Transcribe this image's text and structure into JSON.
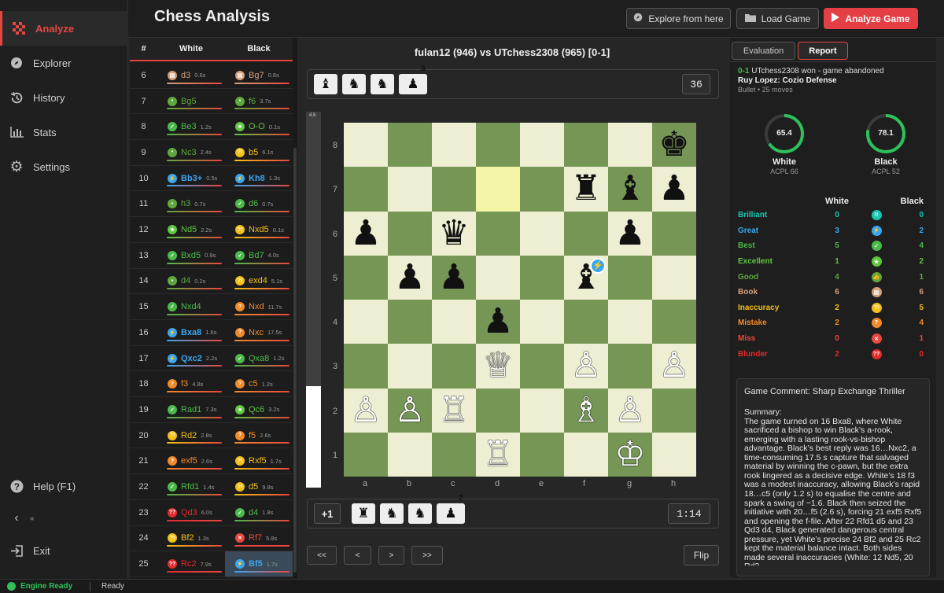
{
  "app": {
    "logo_label": "Analyze",
    "title": "Chess Analysis"
  },
  "sidebar": {
    "items": [
      {
        "label": "Explorer",
        "icon": "compass-icon"
      },
      {
        "label": "History",
        "icon": "history-icon"
      },
      {
        "label": "Stats",
        "icon": "bar-chart-icon"
      },
      {
        "label": "Settings",
        "icon": "gear-icon"
      }
    ],
    "bottom": [
      {
        "label": "Help (F1)",
        "icon": "help-icon"
      },
      {
        "label": "Exit",
        "icon": "exit-icon"
      }
    ],
    "collapse_label": "«"
  },
  "header": {
    "explore_label": "Explore from here",
    "load_label": "Load Game",
    "analyze_label": "Analyze Game"
  },
  "moves_table": {
    "headers": [
      "#",
      "White",
      "Black"
    ],
    "rows": [
      {
        "n": "6",
        "w": "d3",
        "wt": "0.6s",
        "wc": "book",
        "b": "Bg7",
        "bt": "0.6s",
        "bc": "book"
      },
      {
        "n": "7",
        "w": "Bg5",
        "wt": "",
        "wc": "good",
        "b": "f6",
        "bt": "3.7s",
        "bc": "good"
      },
      {
        "n": "8",
        "w": "Be3",
        "wt": "1.2s",
        "wc": "best",
        "b": "O-O",
        "bt": "0.1s",
        "bc": "excellent"
      },
      {
        "n": "9",
        "w": "Nc3",
        "wt": "2.4s",
        "wc": "good",
        "b": "b5",
        "bt": "6.1s",
        "bc": "inaccuracy"
      },
      {
        "n": "10",
        "w": "Bb3+",
        "wt": "0.5s",
        "wc": "great",
        "b": "Kh8",
        "bt": "1.3s",
        "bc": "great"
      },
      {
        "n": "11",
        "w": "h3",
        "wt": "0.7s",
        "wc": "good",
        "b": "d6",
        "bt": "0.7s",
        "bc": "best"
      },
      {
        "n": "12",
        "w": "Nd5",
        "wt": "2.2s",
        "wc": "excellent",
        "b": "Nxd5",
        "bt": "0.1s",
        "bc": "inaccuracy"
      },
      {
        "n": "13",
        "w": "Bxd5",
        "wt": "0.9s",
        "wc": "best",
        "b": "Bd7",
        "bt": "4.0s",
        "bc": "best"
      },
      {
        "n": "14",
        "w": "d4",
        "wt": "0.2s",
        "wc": "good",
        "b": "exd4",
        "bt": "5.1s",
        "bc": "inaccuracy"
      },
      {
        "n": "15",
        "w": "Nxd4",
        "wt": "",
        "wc": "best",
        "b": "Nxd",
        "bt": "11.7s",
        "bc": "mistake"
      },
      {
        "n": "16",
        "w": "Bxa8",
        "wt": "1.6s",
        "wc": "great",
        "b": "Nxc",
        "bt": "17.5s",
        "bc": "mistake"
      },
      {
        "n": "17",
        "w": "Qxc2",
        "wt": "2.2s",
        "wc": "great",
        "b": "Qxa8",
        "bt": "1.2s",
        "bc": "best"
      },
      {
        "n": "18",
        "w": "f3",
        "wt": "4.8s",
        "wc": "mistake",
        "b": "c5",
        "bt": "1.2s",
        "bc": "mistake"
      },
      {
        "n": "19",
        "w": "Rad1",
        "wt": "7.3s",
        "wc": "best",
        "b": "Qc6",
        "bt": "3.2s",
        "bc": "excellent"
      },
      {
        "n": "20",
        "w": "Rd2",
        "wt": "2.8s",
        "wc": "inaccuracy",
        "b": "f5",
        "bt": "2.6s",
        "bc": "mistake"
      },
      {
        "n": "21",
        "w": "exf5",
        "wt": "2.6s",
        "wc": "mistake",
        "b": "Rxf5",
        "bt": "1.7s",
        "bc": "inaccuracy"
      },
      {
        "n": "22",
        "w": "Rfd1",
        "wt": "1.4s",
        "wc": "best",
        "b": "d5",
        "bt": "9.8s",
        "bc": "inaccuracy"
      },
      {
        "n": "23",
        "w": "Qd3",
        "wt": "6.0s",
        "wc": "blunder",
        "b": "d4",
        "bt": "1.8s",
        "bc": "best"
      },
      {
        "n": "24",
        "w": "Bf2",
        "wt": "1.3s",
        "wc": "inaccuracy",
        "b": "Rf7",
        "bt": "5.8s",
        "bc": "miss"
      },
      {
        "n": "25",
        "w": "Rc2",
        "wt": "7.9s",
        "wc": "blunder",
        "b": "Bf5",
        "bt": "1.7s",
        "bc": "great"
      }
    ]
  },
  "game": {
    "players": "fulan12 (946) vs UTchess2308 (965)  [0-1]"
  },
  "top_tray": {
    "pieces": [
      "♝",
      "♞",
      "♞",
      "♟"
    ],
    "superscripts": [
      "",
      "",
      "",
      "3"
    ],
    "value": "36"
  },
  "bottom_tray": {
    "advantage": "+1",
    "pieces": [
      "♜",
      "♞",
      "♞",
      "♟"
    ],
    "superscripts": [
      "",
      "",
      "",
      "2"
    ],
    "clock": "1:14"
  },
  "eval_bar": {
    "label": "4.5",
    "white_fraction": 0.27
  },
  "board": {
    "files": [
      "a",
      "b",
      "c",
      "d",
      "e",
      "f",
      "g",
      "h"
    ],
    "ranks": [
      "8",
      "7",
      "6",
      "5",
      "4",
      "3",
      "2",
      "1"
    ],
    "highlight": [
      "d7"
    ],
    "pieces": [
      {
        "sq": "h8",
        "p": "♚",
        "c": "b"
      },
      {
        "sq": "f7",
        "p": "♜",
        "c": "b"
      },
      {
        "sq": "g7",
        "p": "♝",
        "c": "b"
      },
      {
        "sq": "h7",
        "p": "♟",
        "c": "b"
      },
      {
        "sq": "a6",
        "p": "♟",
        "c": "b"
      },
      {
        "sq": "c6",
        "p": "♛",
        "c": "b"
      },
      {
        "sq": "g6",
        "p": "♟",
        "c": "b"
      },
      {
        "sq": "b5",
        "p": "♟",
        "c": "b"
      },
      {
        "sq": "c5",
        "p": "♟",
        "c": "b"
      },
      {
        "sq": "f5",
        "p": "♝",
        "c": "b"
      },
      {
        "sq": "d4",
        "p": "♟",
        "c": "b"
      },
      {
        "sq": "d3",
        "p": "♕",
        "c": "w"
      },
      {
        "sq": "f3",
        "p": "♙",
        "c": "w"
      },
      {
        "sq": "h3",
        "p": "♙",
        "c": "w"
      },
      {
        "sq": "a2",
        "p": "♙",
        "c": "w"
      },
      {
        "sq": "b2",
        "p": "♙",
        "c": "w"
      },
      {
        "sq": "c2",
        "p": "♖",
        "c": "w"
      },
      {
        "sq": "f2",
        "p": "♗",
        "c": "w"
      },
      {
        "sq": "g2",
        "p": "♙",
        "c": "w"
      },
      {
        "sq": "d1",
        "p": "♖",
        "c": "w"
      },
      {
        "sq": "g1",
        "p": "♔",
        "c": "w"
      }
    ],
    "move_badge": {
      "sq": "f5",
      "type": "great"
    }
  },
  "nav": {
    "first": "<<",
    "prev": "<",
    "next": ">",
    "last": ">>",
    "flip": "Flip"
  },
  "right_panel": {
    "tabs": [
      "Evaluation",
      "Report"
    ],
    "result": "0-1",
    "result_text": "UTchess2308 won - game abandoned",
    "opening": "Ruy Lopez: Cozio Defense",
    "game_type": "Bullet",
    "moves_count": "25 moves",
    "white": {
      "accuracy": "65.4",
      "fraction": 0.654,
      "label": "White",
      "acpl": "ACPL 66"
    },
    "black": {
      "accuracy": "78.1",
      "fraction": 0.781,
      "label": "Black",
      "acpl": "ACPL 52"
    },
    "class_headers": [
      "White",
      "Black"
    ],
    "classes": [
      {
        "name": "Brilliant",
        "w": "0",
        "b": "0",
        "color": "#1bc6b0",
        "icon": "brilliant-icon",
        "glyph": "!!"
      },
      {
        "name": "Great",
        "w": "3",
        "b": "2",
        "color": "#3aa6ee",
        "icon": "great-icon",
        "glyph": "⚡"
      },
      {
        "name": "Best",
        "w": "5",
        "b": "4",
        "color": "#4cba4a",
        "icon": "best-icon",
        "glyph": "✓"
      },
      {
        "name": "Excellent",
        "w": "1",
        "b": "2",
        "color": "#60c640",
        "icon": "excellent-icon",
        "glyph": "★"
      },
      {
        "name": "Good",
        "w": "4",
        "b": "1",
        "color": "#5fa83d",
        "icon": "good-icon",
        "glyph": "👍"
      },
      {
        "name": "Book",
        "w": "6",
        "b": "6",
        "color": "#d3a07a",
        "icon": "book-icon",
        "glyph": "▤"
      },
      {
        "name": "Inaccuracy",
        "w": "2",
        "b": "5",
        "color": "#f3c016",
        "icon": "inaccuracy-icon",
        "glyph": "?!"
      },
      {
        "name": "Mistake",
        "w": "2",
        "b": "4",
        "color": "#f08a2a",
        "icon": "mistake-icon",
        "glyph": "?"
      },
      {
        "name": "Miss",
        "w": "0",
        "b": "1",
        "color": "#e8473f",
        "icon": "miss-icon",
        "glyph": "✕"
      },
      {
        "name": "Blunder",
        "w": "2",
        "b": "0",
        "color": "#e02c2c",
        "icon": "blunder-icon",
        "glyph": "??"
      }
    ],
    "comment_title": "Game Comment: Sharp Exchange Thriller",
    "summary_label": "Summary:",
    "summary": "The game turned on 16 Bxa8, where White sacrificed a bishop to win Black’s a-rook, emerging with a lasting rook-vs-bishop advantage. Black’s best reply was 16…Nxc2, a time-consuming 17.5 s capture that salvaged material by winning the c-pawn, but the extra rook lingered as a decisive edge. White’s 18 f3 was a modest inaccuracy, allowing Black’s rapid 18…c5 (only 1.2 s) to equalise the centre and spark a swing of −1.6. Black then seized the initiative with 20…f5 (2.6 s), forcing 21 exf5 Rxf5 and opening the f-file. After 22 Rfd1 d5 and 23 Qd3 d4, Black generated dangerous central pressure, yet White’s precise 24 Bf2 and 25 Rc2 kept the material balance intact. Both sides made several inaccuracies (White: 12 Nd5, 20 Rd2"
  },
  "status": {
    "engine": "Engine Ready",
    "text": "Ready"
  },
  "colors": {
    "accent": "#e4473f",
    "light_square": "#eeeed2",
    "dark_square": "#769656",
    "highlight": "#f5f5a8"
  }
}
